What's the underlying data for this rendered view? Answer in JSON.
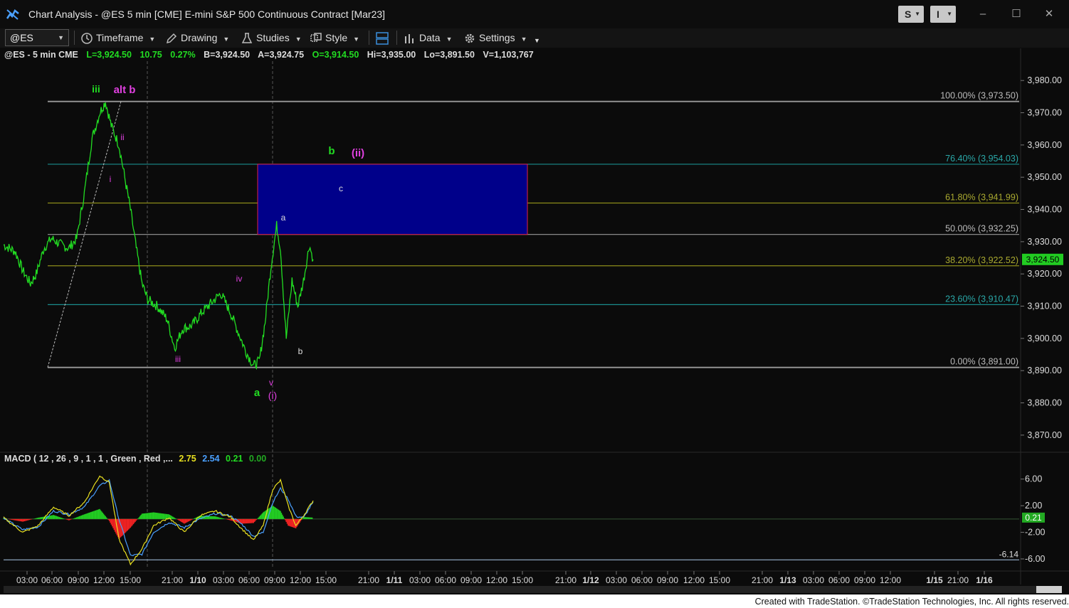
{
  "window": {
    "title": "Chart Analysis - @ES 5 min [CME] E-mini S&P 500 Continuous Contract [Mar23]",
    "btn_s": "S",
    "btn_i": "I"
  },
  "toolbar": {
    "symbol": "@ES",
    "timeframe": "Timeframe",
    "drawing": "Drawing",
    "studies": "Studies",
    "style": "Style",
    "data": "Data",
    "settings": "Settings"
  },
  "quote": {
    "symbol": "@ES - 5 min  CME",
    "last": "L=3,924.50",
    "change": "10.75",
    "pct": "0.27%",
    "bid": "B=3,924.50",
    "ask": "A=3,924.75",
    "open": "O=3,914.50",
    "high": "Hi=3,935.00",
    "low": "Lo=3,891.50",
    "volume": "V=1,103,767"
  },
  "colors": {
    "up": "#22dd22",
    "wave": "#e040e0",
    "fib_teal": "#1a8c8c",
    "fib_olive": "#8c8c1a",
    "fib_gray": "#9a9a9a",
    "box": "#00008a",
    "macd": "#e8e020",
    "signal": "#4aa0ff"
  },
  "chart_data": {
    "type": "line",
    "ylim": [
      3866,
      3986
    ],
    "price_axis": [
      "3,980.00",
      "3,970.00",
      "3,960.00",
      "3,950.00",
      "3,940.00",
      "3,930.00",
      "3,920.00",
      "3,910.00",
      "3,900.00",
      "3,890.00",
      "3,880.00",
      "3,870.00"
    ],
    "last_price_tag": "3,924.50",
    "x_ticks": [
      "03:00",
      "06:00",
      "09:00",
      "12:00",
      "15:00",
      "21:00",
      "1/10",
      "03:00",
      "06:00",
      "09:00",
      "12:00",
      "15:00",
      "21:00",
      "1/11",
      "03:00",
      "06:00",
      "09:00",
      "12:00",
      "15:00",
      "21:00",
      "1/12",
      "03:00",
      "06:00",
      "09:00",
      "12:00",
      "15:00",
      "21:00",
      "1/13",
      "03:00",
      "06:00",
      "09:00",
      "12:00",
      "1/15",
      "21:00",
      "1/16"
    ],
    "price_path": [
      [
        0,
        3929
      ],
      [
        6,
        3927
      ],
      [
        10,
        3921
      ],
      [
        14,
        3917
      ],
      [
        17,
        3920
      ],
      [
        21,
        3928
      ],
      [
        25,
        3931
      ],
      [
        30,
        3929
      ],
      [
        34,
        3928
      ],
      [
        38,
        3931
      ],
      [
        42,
        3945
      ],
      [
        46,
        3962
      ],
      [
        50,
        3970
      ],
      [
        53,
        3973.5
      ],
      [
        56,
        3966
      ],
      [
        60,
        3960
      ],
      [
        63,
        3950
      ],
      [
        66,
        3940
      ],
      [
        69,
        3928
      ],
      [
        72,
        3917
      ],
      [
        75,
        3912
      ],
      [
        80,
        3910
      ],
      [
        85,
        3906
      ],
      [
        89,
        3897
      ],
      [
        93,
        3903
      ],
      [
        98,
        3904
      ],
      [
        103,
        3908
      ],
      [
        108,
        3911
      ],
      [
        113,
        3914
      ],
      [
        118,
        3908
      ],
      [
        122,
        3902
      ],
      [
        126,
        3896
      ],
      [
        130,
        3891.5
      ],
      [
        133,
        3893
      ],
      [
        136,
        3905
      ],
      [
        139,
        3922
      ],
      [
        142,
        3935
      ],
      [
        144,
        3928
      ],
      [
        147,
        3900
      ],
      [
        150,
        3918
      ],
      [
        153,
        3910
      ],
      [
        156,
        3918
      ],
      [
        159,
        3929
      ],
      [
        161,
        3924.5
      ]
    ],
    "fib_levels": [
      {
        "label": "100.00% (3,973.50)",
        "value": 3973.5
      },
      {
        "label": "76.40% (3,954.03)",
        "value": 3954.03
      },
      {
        "label": "61.80% (3,941.99)",
        "value": 3941.99
      },
      {
        "label": "50.00% (3,932.25)",
        "value": 3932.25
      },
      {
        "label": "38.20% (3,922.52)",
        "value": 3922.52
      },
      {
        "label": "23.60% (3,910.47)",
        "value": 3910.47
      },
      {
        "label": "0.00% (3,891.00)",
        "value": 3891
      }
    ],
    "target_box": {
      "top": 3954.03,
      "bottom": 3932.25
    },
    "wave_labels": {
      "iii_green": "iii",
      "alt_b": "alt b",
      "ii": "ii",
      "i": "i",
      "iii_purple": "iii",
      "iv": "iv",
      "v": "v",
      "a_green": "a",
      "wave_i": "(i)",
      "a_white": "a",
      "b_white": "b",
      "c_white": "c",
      "b_green": "b",
      "wave_ii": "(ii)"
    },
    "macd": {
      "label": "MACD ( 12 , 26 , 9 , 1 , 1 , Green , Red ,...",
      "macd_value": "2.75",
      "signal_value": "2.54",
      "histogram_value": "0.21",
      "zero_value": "0.00",
      "axis_ticks": [
        "6.00",
        "2.00",
        "-2.00",
        "-6.00"
      ],
      "current_tag": "0.21",
      "min_label": "-6.14",
      "ylim": [
        -7.5,
        8
      ],
      "macd_path": [
        [
          0,
          0.2
        ],
        [
          10,
          -2
        ],
        [
          18,
          -1
        ],
        [
          26,
          1.8
        ],
        [
          34,
          0.5
        ],
        [
          42,
          2.5
        ],
        [
          50,
          6.5
        ],
        [
          55,
          5.5
        ],
        [
          60,
          -3
        ],
        [
          66,
          -6.8
        ],
        [
          72,
          -4.5
        ],
        [
          78,
          -1
        ],
        [
          86,
          0.2
        ],
        [
          94,
          -2
        ],
        [
          102,
          0.5
        ],
        [
          110,
          1.2
        ],
        [
          118,
          0.3
        ],
        [
          124,
          -1.5
        ],
        [
          130,
          -3.2
        ],
        [
          135,
          -1
        ],
        [
          140,
          4.5
        ],
        [
          144,
          5.8
        ],
        [
          148,
          2
        ],
        [
          152,
          -1
        ],
        [
          156,
          0.5
        ],
        [
          161,
          2.75
        ]
      ],
      "signal_path": [
        [
          0,
          0.1
        ],
        [
          10,
          -1.6
        ],
        [
          18,
          -1.2
        ],
        [
          26,
          1.2
        ],
        [
          34,
          0.7
        ],
        [
          42,
          1.8
        ],
        [
          50,
          5
        ],
        [
          55,
          5.8
        ],
        [
          60,
          0
        ],
        [
          66,
          -5.5
        ],
        [
          72,
          -5.3
        ],
        [
          78,
          -2
        ],
        [
          86,
          -0.5
        ],
        [
          94,
          -1.3
        ],
        [
          102,
          0
        ],
        [
          110,
          0.8
        ],
        [
          118,
          0.5
        ],
        [
          124,
          -0.8
        ],
        [
          130,
          -2.6
        ],
        [
          135,
          -2
        ],
        [
          140,
          2.5
        ],
        [
          144,
          4.6
        ],
        [
          148,
          3
        ],
        [
          152,
          0.4
        ],
        [
          156,
          0.2
        ],
        [
          161,
          2.54
        ]
      ],
      "hist_path": [
        [
          0,
          0.1
        ],
        [
          10,
          -0.4
        ],
        [
          18,
          0.2
        ],
        [
          26,
          0.6
        ],
        [
          34,
          -0.2
        ],
        [
          42,
          0.7
        ],
        [
          50,
          1.5
        ],
        [
          55,
          -0.3
        ],
        [
          60,
          -3
        ],
        [
          66,
          -1.3
        ],
        [
          72,
          0.8
        ],
        [
          78,
          1
        ],
        [
          86,
          0.7
        ],
        [
          94,
          -0.7
        ],
        [
          102,
          0.5
        ],
        [
          110,
          0.4
        ],
        [
          118,
          -0.2
        ],
        [
          124,
          -0.7
        ],
        [
          130,
          -0.6
        ],
        [
          135,
          1
        ],
        [
          140,
          2
        ],
        [
          144,
          1.2
        ],
        [
          148,
          -1
        ],
        [
          152,
          -1.4
        ],
        [
          156,
          0.3
        ],
        [
          161,
          0.21
        ]
      ]
    }
  },
  "footer": {
    "text": "Created with TradeStation. ©TradeStation Technologies, Inc. All rights reserved."
  }
}
